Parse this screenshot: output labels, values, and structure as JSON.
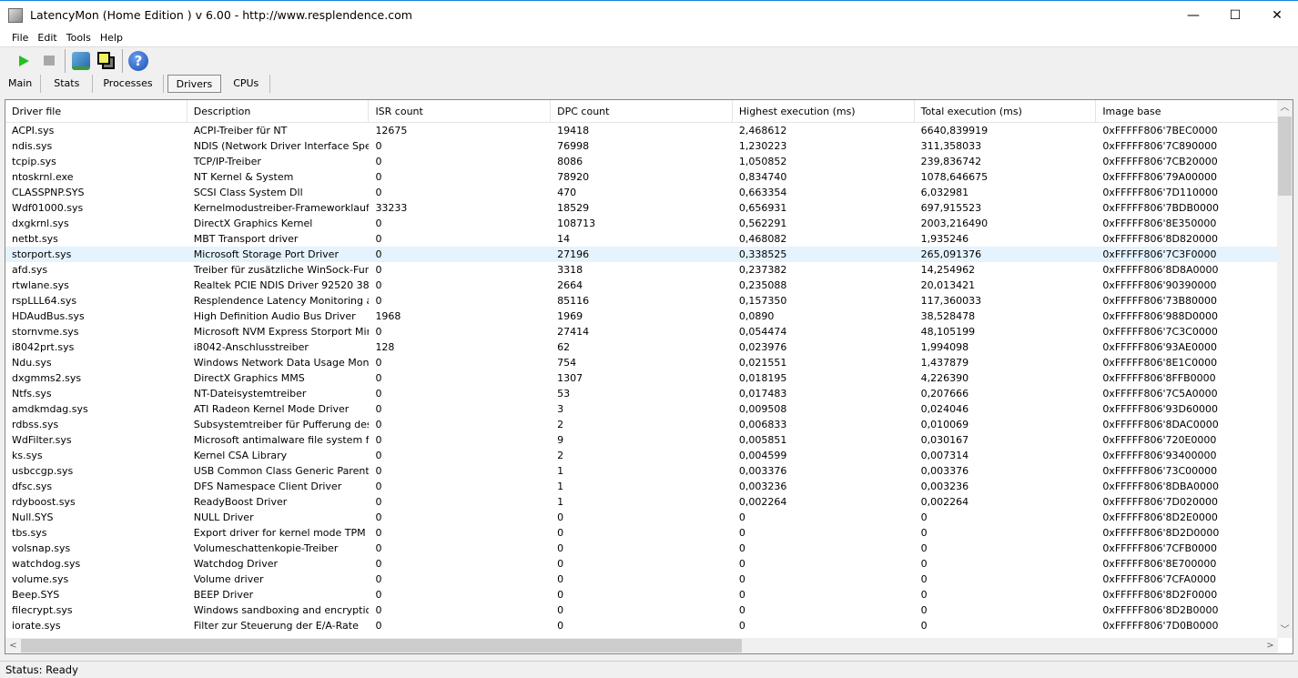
{
  "window": {
    "title": "LatencyMon  (Home Edition )  v 6.00 - http://www.resplendence.com",
    "minimize": "—",
    "maximize": "☐",
    "close": "✕"
  },
  "menu": [
    "File",
    "Edit",
    "Tools",
    "Help"
  ],
  "toolbar": {
    "icons": [
      "play-icon",
      "stop-icon",
      "driver-search-icon",
      "windows-icon",
      "help-icon"
    ],
    "help_glyph": "?"
  },
  "tabs": [
    {
      "label": "Main"
    },
    {
      "label": "Stats"
    },
    {
      "label": "Processes"
    },
    {
      "label": "Drivers",
      "active": true
    },
    {
      "label": "CPUs"
    }
  ],
  "table": {
    "columns": [
      "Driver file",
      "Description",
      "ISR count",
      "DPC count",
      "Highest execution (ms)",
      "Total execution (ms)",
      "Image base"
    ],
    "rows": [
      [
        "ACPI.sys",
        "ACPI-Treiber für NT",
        "12675",
        "19418",
        "2,468612",
        "6640,839919",
        "0xFFFFF806'7BEC0000"
      ],
      [
        "ndis.sys",
        "NDIS (Network Driver Interface Spe...",
        "0",
        "76998",
        "1,230223",
        "311,358033",
        "0xFFFFF806'7C890000"
      ],
      [
        "tcpip.sys",
        "TCP/IP-Treiber",
        "0",
        "8086",
        "1,050852",
        "239,836742",
        "0xFFFFF806'7CB20000"
      ],
      [
        "ntoskrnl.exe",
        "NT Kernel & System",
        "0",
        "78920",
        "0,834740",
        "1078,646675",
        "0xFFFFF806'79A00000"
      ],
      [
        "CLASSPNP.SYS",
        "SCSI Class System Dll",
        "0",
        "470",
        "0,663354",
        "6,032981",
        "0xFFFFF806'7D110000"
      ],
      [
        "Wdf01000.sys",
        "Kernelmodustreiber-Frameworklaufzeit",
        "33233",
        "18529",
        "0,656931",
        "697,915523",
        "0xFFFFF806'7BDB0000"
      ],
      [
        "dxgkrnl.sys",
        "DirectX Graphics Kernel",
        "0",
        "108713",
        "0,562291",
        "2003,216490",
        "0xFFFFF806'8E350000"
      ],
      [
        "netbt.sys",
        "MBT Transport driver",
        "0",
        "14",
        "0,468082",
        "1,935246",
        "0xFFFFF806'8D820000"
      ],
      [
        "storport.sys",
        "Microsoft Storage Port Driver",
        "0",
        "27196",
        "0,338525",
        "265,091376",
        "0xFFFFF806'7C3F0000"
      ],
      [
        "afd.sys",
        "Treiber für zusätzliche WinSock-Fun...",
        "0",
        "3318",
        "0,237382",
        "14,254962",
        "0xFFFFF806'8D8A0000"
      ],
      [
        "rtwlane.sys",
        "Realtek PCIE NDIS Driver 92520 38...",
        "0",
        "2664",
        "0,235088",
        "20,013421",
        "0xFFFFF806'90390000"
      ],
      [
        "rspLLL64.sys",
        "Resplendence Latency Monitoring a...",
        "0",
        "85116",
        "0,157350",
        "117,360033",
        "0xFFFFF806'73B80000"
      ],
      [
        "HDAudBus.sys",
        "High Definition Audio Bus Driver",
        "1968",
        "1969",
        "0,0890",
        "38,528478",
        "0xFFFFF806'988D0000"
      ],
      [
        "stornvme.sys",
        "Microsoft NVM Express Storport Mini...",
        "0",
        "27414",
        "0,054474",
        "48,105199",
        "0xFFFFF806'7C3C0000"
      ],
      [
        "i8042prt.sys",
        "i8042-Anschlusstreiber",
        "128",
        "62",
        "0,023976",
        "1,994098",
        "0xFFFFF806'93AE0000"
      ],
      [
        "Ndu.sys",
        "Windows Network Data Usage Monit...",
        "0",
        "754",
        "0,021551",
        "1,437879",
        "0xFFFFF806'8E1C0000"
      ],
      [
        "dxgmms2.sys",
        "DirectX Graphics MMS",
        "0",
        "1307",
        "0,018195",
        "4,226390",
        "0xFFFFF806'8FFB0000"
      ],
      [
        "Ntfs.sys",
        "NT-Dateisystemtreiber",
        "0",
        "53",
        "0,017483",
        "0,207666",
        "0xFFFFF806'7C5A0000"
      ],
      [
        "amdkmdag.sys",
        "ATI Radeon Kernel Mode Driver",
        "0",
        "3",
        "0,009508",
        "0,024046",
        "0xFFFFF806'93D60000"
      ],
      [
        "rdbss.sys",
        "Subsystemtreiber für Pufferung des...",
        "0",
        "2",
        "0,006833",
        "0,010069",
        "0xFFFFF806'8DAC0000"
      ],
      [
        "WdFilter.sys",
        "Microsoft antimalware file system filt...",
        "0",
        "9",
        "0,005851",
        "0,030167",
        "0xFFFFF806'720E0000"
      ],
      [
        "ks.sys",
        "Kernel CSA Library",
        "0",
        "2",
        "0,004599",
        "0,007314",
        "0xFFFFF806'93400000"
      ],
      [
        "usbccgp.sys",
        "USB Common Class Generic Parent ...",
        "0",
        "1",
        "0,003376",
        "0,003376",
        "0xFFFFF806'73C00000"
      ],
      [
        "dfsc.sys",
        "DFS Namespace Client Driver",
        "0",
        "1",
        "0,003236",
        "0,003236",
        "0xFFFFF806'8DBA0000"
      ],
      [
        "rdyboost.sys",
        "ReadyBoost Driver",
        "0",
        "1",
        "0,002264",
        "0,002264",
        "0xFFFFF806'7D020000"
      ],
      [
        "Null.SYS",
        "NULL Driver",
        "0",
        "0",
        "0",
        "0",
        "0xFFFFF806'8D2E0000"
      ],
      [
        "tbs.sys",
        "Export driver for kernel mode TPM API",
        "0",
        "0",
        "0",
        "0",
        "0xFFFFF806'8D2D0000"
      ],
      [
        "volsnap.sys",
        "Volumeschattenkopie-Treiber",
        "0",
        "0",
        "0",
        "0",
        "0xFFFFF806'7CFB0000"
      ],
      [
        "watchdog.sys",
        "Watchdog Driver",
        "0",
        "0",
        "0",
        "0",
        "0xFFFFF806'8E700000"
      ],
      [
        "volume.sys",
        "Volume driver",
        "0",
        "0",
        "0",
        "0",
        "0xFFFFF806'7CFA0000"
      ],
      [
        "Beep.SYS",
        "BEEP Driver",
        "0",
        "0",
        "0",
        "0",
        "0xFFFFF806'8D2F0000"
      ],
      [
        "filecrypt.sys",
        "Windows sandboxing and encryptio...",
        "0",
        "0",
        "0",
        "0",
        "0xFFFFF806'8D2B0000"
      ],
      [
        "iorate.sys",
        "Filter zur Steuerung der E/A-Rate",
        "0",
        "0",
        "0",
        "0",
        "0xFFFFF806'7D0B0000"
      ]
    ],
    "selected_row": 8
  },
  "status": "Status: Ready"
}
